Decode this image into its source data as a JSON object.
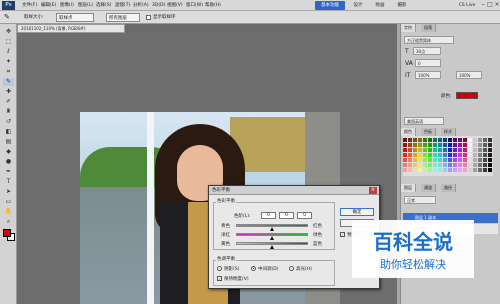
{
  "menubar": {
    "items": [
      "文件(F)",
      "编辑(E)",
      "图像(I)",
      "图层(L)",
      "选择(S)",
      "滤镜(T)",
      "分析(A)",
      "3D(D)",
      "视图(V)",
      "窗口(W)",
      "帮助(H)"
    ],
    "modes": [
      "基本功能",
      "设计",
      "绘画",
      "摄影"
    ],
    "cs_live": "CS Live"
  },
  "optbar": {
    "sample_label": "取样大小:",
    "sample_value": "取样点",
    "sample_value2": "所有图层",
    "show_ring_label": "显示取样环"
  },
  "doc_tab": "20161102_110% (背景, RGB/8#)",
  "dialog": {
    "title": "色彩平衡",
    "balance_group": "色彩平衡",
    "levels_label": "色阶(L):",
    "levels": [
      "0",
      "0",
      "0"
    ],
    "sliders": [
      {
        "left": "青色",
        "right": "红色",
        "value": 0
      },
      {
        "left": "洋红",
        "right": "绿色",
        "value": 0
      },
      {
        "left": "黄色",
        "right": "蓝色",
        "value": 0
      }
    ],
    "tone_group": "色调平衡",
    "tones": [
      "阴影(S)",
      "中间调(D)",
      "高光(H)"
    ],
    "selected_tone": "中间调(D)",
    "preserve_label": "保持明度(V)",
    "ok": "确定",
    "cancel": "取消",
    "preview": "预览(P)"
  },
  "panels": {
    "tabs": [
      "字符",
      "段落"
    ],
    "font": "方正粗黑简体",
    "size": "30点",
    "tracking": "0",
    "scale": "100%",
    "color_label": "颜色:",
    "lang": "美国英语",
    "swatch_tabs": [
      "颜色",
      "色板",
      "样式"
    ],
    "layer_tabs": [
      "图层",
      "通道",
      "路径"
    ],
    "layer_mode": "正常",
    "layer_name": "图层 1 副本",
    "layer_bg": "背景"
  },
  "colors": {
    "accent": "#2f65c8",
    "foreground": "#d40000",
    "watermark": "#1a6fc9"
  },
  "watermark": {
    "title": "百科全说",
    "subtitle": "助你轻松解决"
  }
}
